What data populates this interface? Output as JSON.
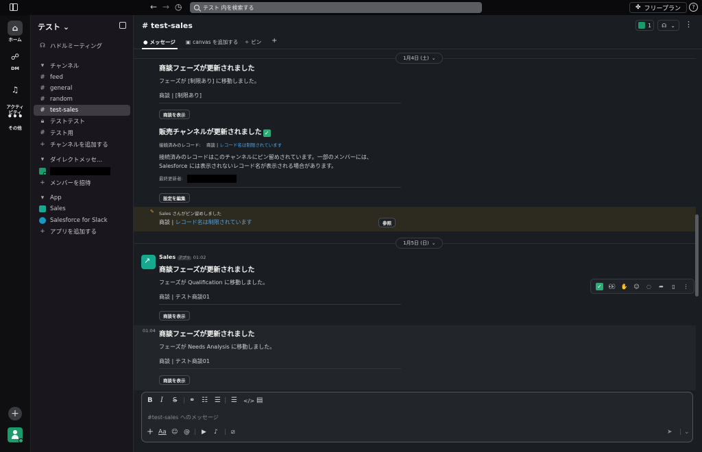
{
  "search": {
    "placeholder": "テスト 内を検索する"
  },
  "topbar": {
    "plan_label": "フリープラン",
    "help": "?"
  },
  "rail": {
    "items": [
      {
        "label": "ホーム"
      },
      {
        "label": "DM"
      },
      {
        "label": "アクティ\nビティ"
      },
      {
        "label": "その他"
      }
    ]
  },
  "sidebar": {
    "workspace": "テスト",
    "huddle": "ハドルミーティング",
    "channels_header": "チャンネル",
    "channels": [
      "feed",
      "general",
      "random",
      "test-sales",
      "テストテスト",
      "テスト用"
    ],
    "add_channel": "チャンネルを追加する",
    "dm_header": "ダイレクトメッセ...",
    "invite": "メンバーを招待",
    "apps_header": "App",
    "apps": [
      "Sales",
      "Salesforce for Slack"
    ],
    "add_app": "アプリを追加する"
  },
  "channel": {
    "title": "# test-sales",
    "member_count": "1",
    "tabs": {
      "messages": "メッセージ",
      "canvas": "canvas を追加する",
      "pins": "ピン",
      "add": "+"
    }
  },
  "messages": {
    "date1": "1月4日 (土)",
    "m1_title": "商談フェーズが更新されました",
    "m1_body": "フェーズが [制限あり] に移動しました。",
    "m1_record": "商談 | [制限あり]",
    "view_deal": "商談を表示",
    "m2_title": "販売チャンネルが更新されました",
    "m2_records_label": "接続済みのレコード:",
    "m2_records_prefix": "商談 |",
    "m2_records_link": "レコード名は制限されています",
    "m2_body1": "接続済みのレコードはこのチャンネルにピン留めされています。一部のメンバーには、",
    "m2_body2": "Salesforce には表示されないレコード名が表示される場合があります。",
    "m2_updated": "最終更新者:",
    "edit_settings": "設定を編集",
    "pin_notice": "Sales さんがピン留めしました",
    "pin_prefix": "商談 |",
    "pin_link": "レコード名は制限されています",
    "pin_view": "参照",
    "date2": "1月5日 (日)",
    "sender": "Sales",
    "app_tag": "アプリ",
    "time1": "01:02",
    "m3_title": "商談フェーズが更新されました",
    "m3_body": "フェーズが Qualification に移動しました。",
    "m3_record": "商談 | テスト商談01",
    "time2": "01:04",
    "m4_title": "商談フェーズが更新されました",
    "m4_body": "フェーズが Needs Analysis に移動しました。",
    "m4_record": "商談 | テスト商談01"
  },
  "composer": {
    "placeholder": "#test-sales へのメッセージ"
  }
}
